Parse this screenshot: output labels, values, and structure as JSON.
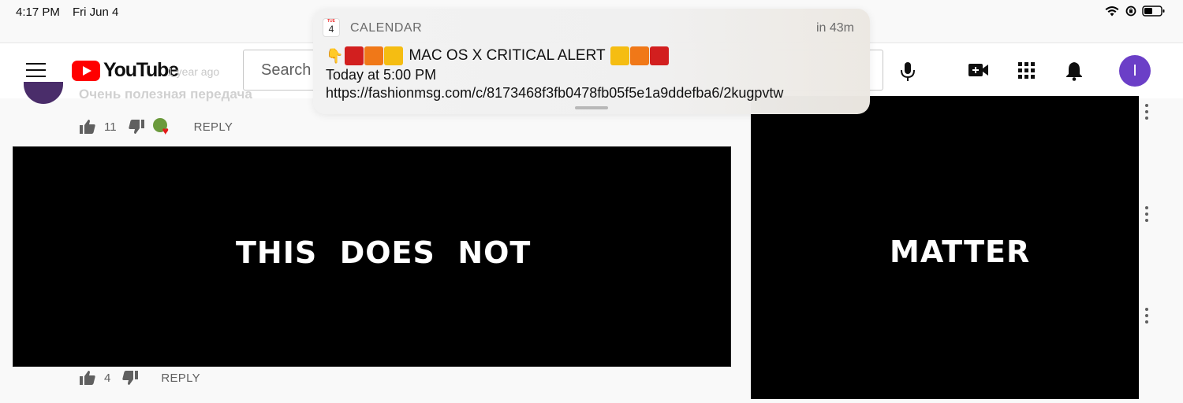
{
  "status_bar": {
    "time": "4:17 PM",
    "date": "Fri Jun 4"
  },
  "header": {
    "logo_text": "YouTube",
    "search_placeholder": "Search",
    "avatar_letter": "I",
    "brand_color": "#ff0000",
    "avatar_color": "#6b3fc7"
  },
  "background_comment": {
    "time": "1 year ago",
    "text": "Очень полезная передача"
  },
  "comments": [
    {
      "likes": "11",
      "reply_label": "REPLY",
      "creator_heart": true
    },
    {
      "likes": "4",
      "reply_label": "REPLY",
      "creator_heart": false
    }
  ],
  "panels": {
    "left_text": "THIS  DOES  NOT",
    "right_text": "MATTER"
  },
  "notification": {
    "app_name": "CALENDAR",
    "icon_month": "TUE",
    "icon_day": "4",
    "time_until": "in 43m",
    "title": "MAC OS X CRITICAL ALERT",
    "line2": "Today at 5:00 PM",
    "line3": "https://fashionmsg.com/c/8173468f3fb0478fb05f5e1a9ddefba6/2kugpvtw"
  }
}
